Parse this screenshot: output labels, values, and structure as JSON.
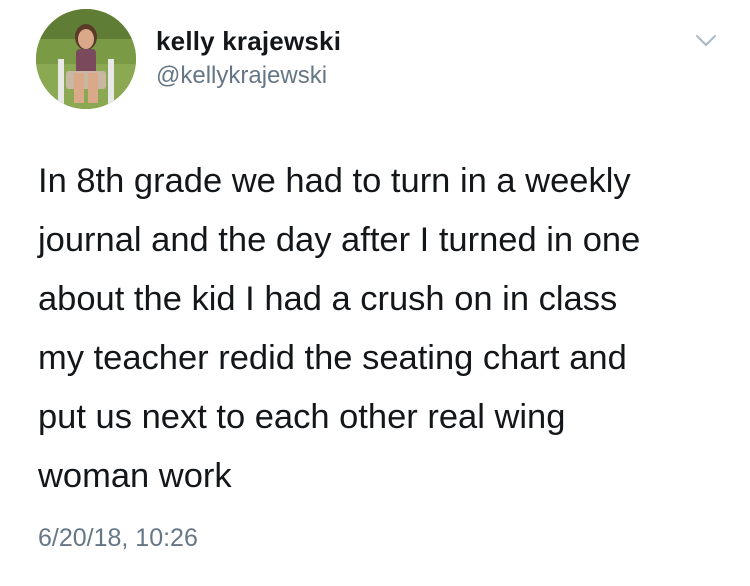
{
  "user": {
    "display_name": "kelly krajewski",
    "handle": "@kellykrajewski"
  },
  "tweet": {
    "lines": [
      "In 8th grade we had to turn in a weekly",
      "journal and the day after I turned in one",
      "about the kid I had a crush on in class",
      "my teacher redid the seating chart and",
      "put us next to each other real wing",
      "woman work"
    ],
    "timestamp": "6/20/18, 10:26"
  },
  "icons": {
    "menu": "chevron-down-icon",
    "avatar": "profile-photo"
  },
  "colors": {
    "text": "#14171a",
    "secondary": "#657786",
    "chevron": "#aab8c2"
  }
}
